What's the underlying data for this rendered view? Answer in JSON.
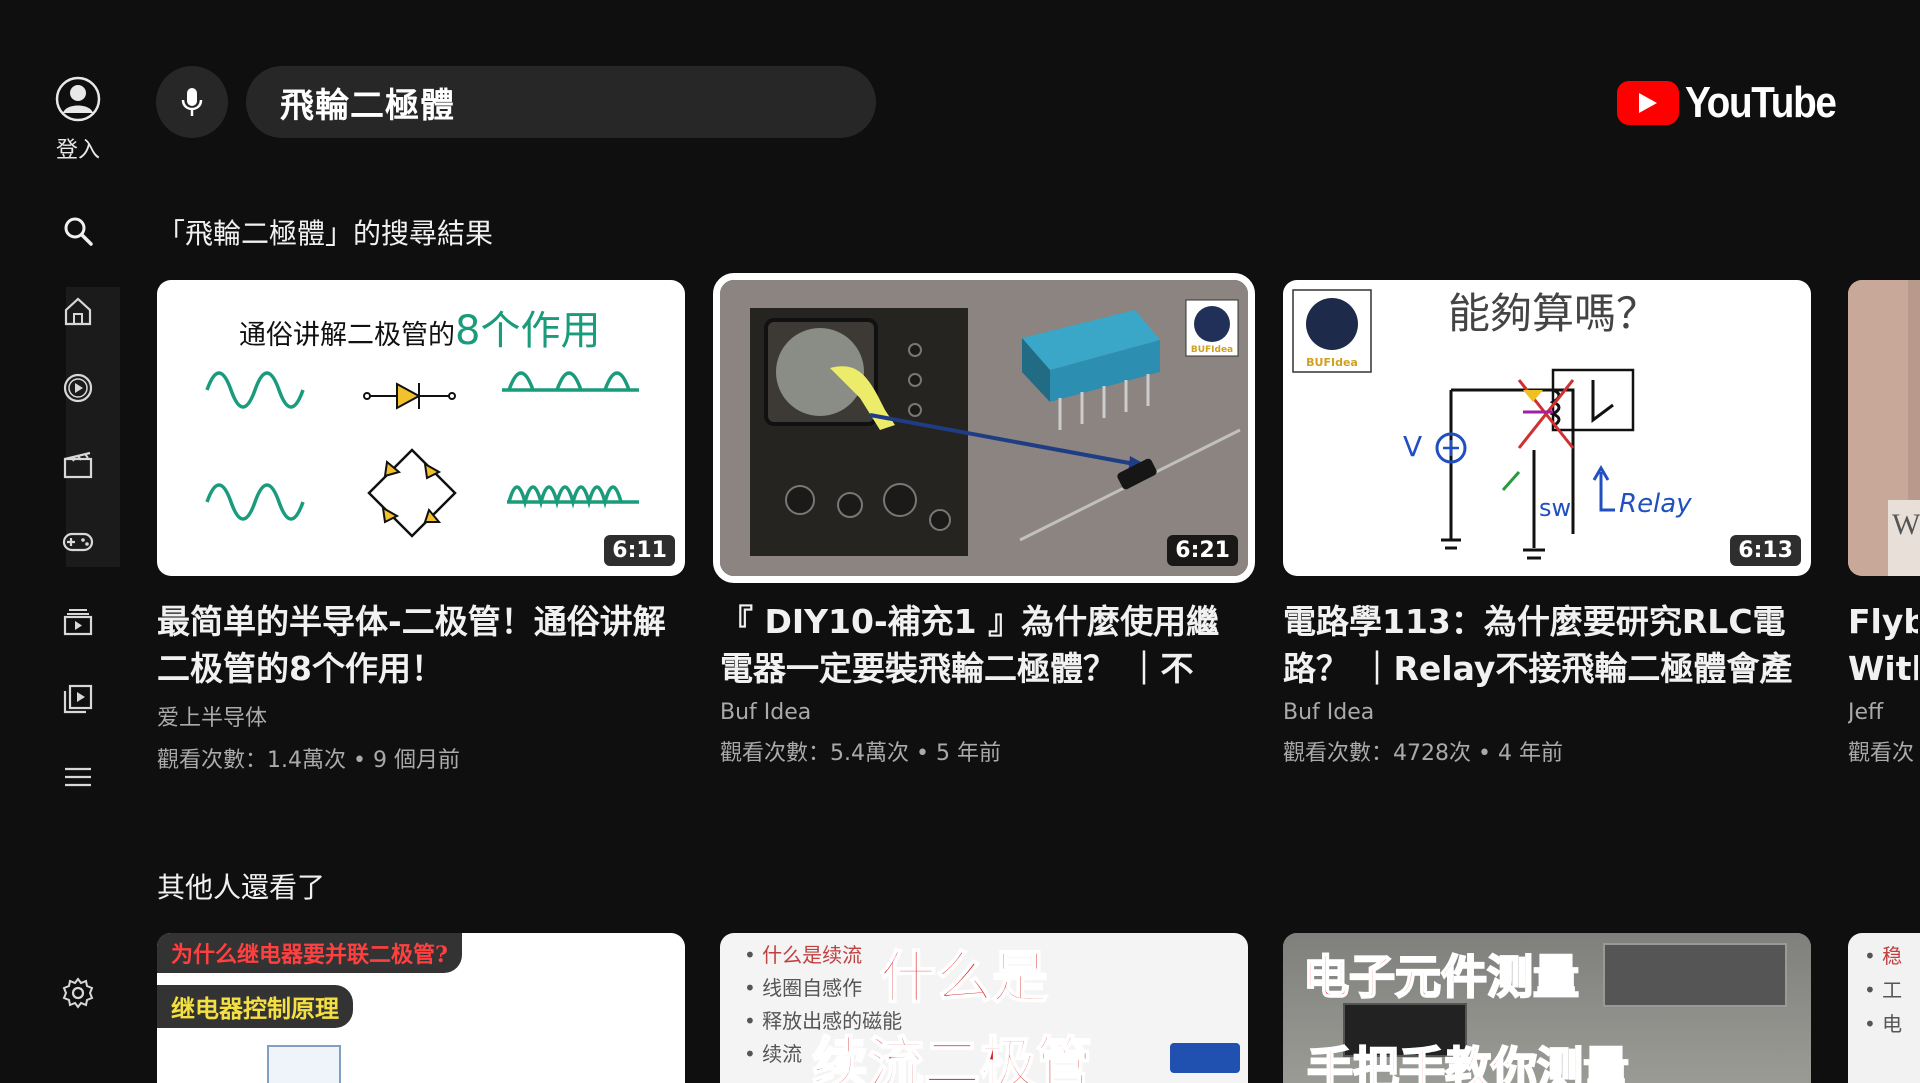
{
  "account": {
    "signin_label": "登入"
  },
  "rail": {
    "items": [
      {
        "name": "search-icon"
      },
      {
        "name": "home-icon"
      },
      {
        "name": "subscriptions-icon"
      },
      {
        "name": "movies-icon"
      },
      {
        "name": "gaming-icon"
      },
      {
        "name": "queue-icon"
      },
      {
        "name": "library-icon"
      },
      {
        "name": "menu-icon"
      },
      {
        "name": "settings-icon"
      }
    ]
  },
  "search": {
    "query": "飛輪二極體"
  },
  "brand": {
    "name": "YouTube",
    "accent": "#ff0000"
  },
  "results": {
    "heading": "「飛輪二極體」的搜尋結果",
    "videos": [
      {
        "title": "最简单的半导体-二极管！通俗讲解二极管的8个作用！",
        "channel": "爱上半导体",
        "meta": "觀看次數：1.4萬次 • 9 個月前",
        "duration": "6:11",
        "thumb_text": {
          "prefix": "通俗讲解二极管的",
          "highlight": "8个作用"
        }
      },
      {
        "title": "『 DIY10-補充1 』為什麼使用繼電器一定要裝飛輪二極體？ ｜不",
        "channel": "Buf Idea",
        "meta": "觀看次數：5.4萬次 • 5 年前",
        "duration": "6:21",
        "thumb_text": {
          "badge": "BUFIdea"
        }
      },
      {
        "title": "電路學113：為什麼要研究RLC電路？ ｜Relay不接飛輪二極體會產",
        "channel": "Buf Idea",
        "meta": "觀看次數：4728次 • 4 年前",
        "duration": "6:13",
        "thumb_text": {
          "headline": "能夠算嗎？",
          "v": "V",
          "sw": "sw",
          "relay": "Relay",
          "badge": "BUFIdea"
        }
      },
      {
        "title": "Flyb With",
        "channel": "Jeff",
        "meta": "觀看次",
        "duration": "",
        "thumb_text": {
          "glyph": "W"
        }
      }
    ]
  },
  "related": {
    "heading": "其他人還看了",
    "videos": [
      {
        "caption_1": "为什么继电器要并联二极管?",
        "caption_2": "继电器控制原理"
      },
      {
        "bullet_1": "什么是续流",
        "bullet_2": "线圈自感作",
        "bullet_3": "释放出感的磁能",
        "bullet_4": "续流",
        "big_1": "什么是",
        "big_2": "续流二极管"
      },
      {
        "big_1": "电子元件测量",
        "big_2": "手把手教你测量"
      },
      {
        "bullet_1": "稳",
        "bullet_2": "工",
        "bullet_3": "电"
      }
    ]
  }
}
